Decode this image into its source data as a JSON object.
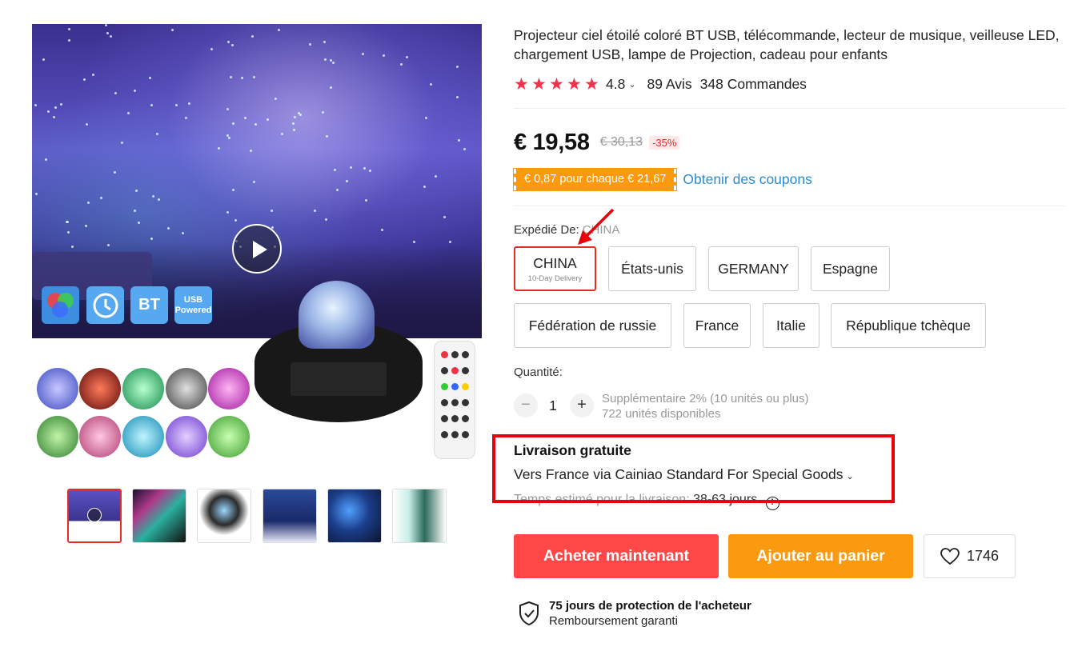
{
  "product": {
    "title": "Projecteur ciel étoilé coloré BT USB, télécommande, lecteur de musique, veilleuse LED, chargement USB, lampe de Projection, cadeau pour enfants",
    "rating": "4.8",
    "reviews": "89 Avis",
    "orders": "348 Commandes",
    "stars_filled": 5
  },
  "gallery": {
    "badges": {
      "bt": "BT",
      "usb": "USB Powered"
    },
    "thumbnails_count": 6,
    "active_thumbnail": 1
  },
  "price": {
    "current": "€ 19,58",
    "original": "€ 30,13",
    "discount": "-35%"
  },
  "coupon": {
    "badge": "€ 0,87 pour chaque € 21,67",
    "link": "Obtenir des coupons"
  },
  "shipping_from": {
    "label": "Expédié De:",
    "value": "CHINA",
    "options": [
      {
        "label": "CHINA",
        "sub": "10-Day Delivery",
        "selected": true
      },
      {
        "label": "États-unis"
      },
      {
        "label": "GERMANY"
      },
      {
        "label": "Espagne"
      },
      {
        "label": "Fédération de russie"
      },
      {
        "label": "France"
      },
      {
        "label": "Italie"
      },
      {
        "label": "République tchèque"
      }
    ]
  },
  "quantity": {
    "label": "Quantité:",
    "value": "1",
    "extra": "Supplémentaire 2% (10 unités ou plus)",
    "available": "722 unités disponibles"
  },
  "delivery": {
    "title": "Livraison gratuite",
    "route": "Vers France via Cainiao Standard For Special Goods",
    "time_label": "Temps estimé pour la livraison:",
    "time_value": "38-63 jours"
  },
  "actions": {
    "buy_now": "Acheter maintenant",
    "add_cart": "Ajouter au panier",
    "wishlist_count": "1746"
  },
  "protection": {
    "title": "75 jours de protection de l'acheteur",
    "subtitle": "Remboursement garanti"
  },
  "colors": {
    "accent_red": "#ff4747",
    "accent_orange": "#fb9a0e",
    "link_blue": "#2d8ccf",
    "star_red": "#f0334a"
  }
}
